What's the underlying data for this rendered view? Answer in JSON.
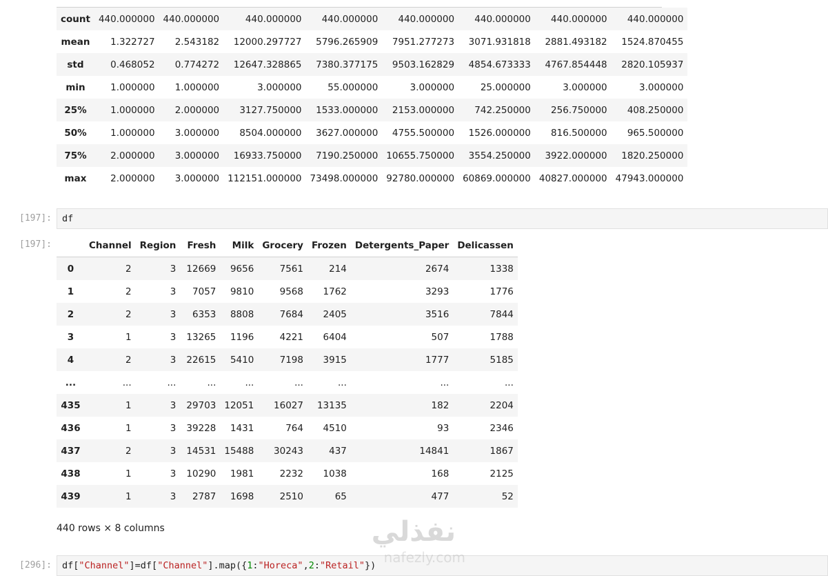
{
  "describe": {
    "rows": [
      {
        "label": "count",
        "values": [
          "440.000000",
          "440.000000",
          "440.000000",
          "440.000000",
          "440.000000",
          "440.000000",
          "440.000000",
          "440.000000"
        ]
      },
      {
        "label": "mean",
        "values": [
          "1.322727",
          "2.543182",
          "12000.297727",
          "5796.265909",
          "7951.277273",
          "3071.931818",
          "2881.493182",
          "1524.870455"
        ]
      },
      {
        "label": "std",
        "values": [
          "0.468052",
          "0.774272",
          "12647.328865",
          "7380.377175",
          "9503.162829",
          "4854.673333",
          "4767.854448",
          "2820.105937"
        ]
      },
      {
        "label": "min",
        "values": [
          "1.000000",
          "1.000000",
          "3.000000",
          "55.000000",
          "3.000000",
          "25.000000",
          "3.000000",
          "3.000000"
        ]
      },
      {
        "label": "25%",
        "values": [
          "1.000000",
          "2.000000",
          "3127.750000",
          "1533.000000",
          "2153.000000",
          "742.250000",
          "256.750000",
          "408.250000"
        ]
      },
      {
        "label": "50%",
        "values": [
          "1.000000",
          "3.000000",
          "8504.000000",
          "3627.000000",
          "4755.500000",
          "1526.000000",
          "816.500000",
          "965.500000"
        ]
      },
      {
        "label": "75%",
        "values": [
          "2.000000",
          "3.000000",
          "16933.750000",
          "7190.250000",
          "10655.750000",
          "3554.250000",
          "3922.000000",
          "1820.250000"
        ]
      },
      {
        "label": "max",
        "values": [
          "2.000000",
          "3.000000",
          "112151.000000",
          "73498.000000",
          "92780.000000",
          "60869.000000",
          "40827.000000",
          "47943.000000"
        ]
      }
    ]
  },
  "cell_197": {
    "prompt_in": "[197]:",
    "code": "df",
    "prompt_out": "[197]:"
  },
  "df": {
    "columns": [
      "Channel",
      "Region",
      "Fresh",
      "Milk",
      "Grocery",
      "Frozen",
      "Detergents_Paper",
      "Delicassen"
    ],
    "rows": [
      {
        "index": "0",
        "values": [
          "2",
          "3",
          "12669",
          "9656",
          "7561",
          "214",
          "2674",
          "1338"
        ]
      },
      {
        "index": "1",
        "values": [
          "2",
          "3",
          "7057",
          "9810",
          "9568",
          "1762",
          "3293",
          "1776"
        ]
      },
      {
        "index": "2",
        "values": [
          "2",
          "3",
          "6353",
          "8808",
          "7684",
          "2405",
          "3516",
          "7844"
        ]
      },
      {
        "index": "3",
        "values": [
          "1",
          "3",
          "13265",
          "1196",
          "4221",
          "6404",
          "507",
          "1788"
        ]
      },
      {
        "index": "4",
        "values": [
          "2",
          "3",
          "22615",
          "5410",
          "7198",
          "3915",
          "1777",
          "5185"
        ]
      },
      {
        "index": "...",
        "values": [
          "...",
          "...",
          "...",
          "...",
          "...",
          "...",
          "...",
          "..."
        ]
      },
      {
        "index": "435",
        "values": [
          "1",
          "3",
          "29703",
          "12051",
          "16027",
          "13135",
          "182",
          "2204"
        ]
      },
      {
        "index": "436",
        "values": [
          "1",
          "3",
          "39228",
          "1431",
          "764",
          "4510",
          "93",
          "2346"
        ]
      },
      {
        "index": "437",
        "values": [
          "2",
          "3",
          "14531",
          "15488",
          "30243",
          "437",
          "14841",
          "1867"
        ]
      },
      {
        "index": "438",
        "values": [
          "1",
          "3",
          "10290",
          "1981",
          "2232",
          "1038",
          "168",
          "2125"
        ]
      },
      {
        "index": "439",
        "values": [
          "1",
          "3",
          "2787",
          "1698",
          "2510",
          "65",
          "477",
          "52"
        ]
      }
    ],
    "shape_note": "440 rows × 8 columns"
  },
  "cell_296": {
    "prompt_in": "[296]:",
    "code_tokens": [
      {
        "t": "df[",
        "k": "p"
      },
      {
        "t": "\"Channel\"",
        "k": "s"
      },
      {
        "t": "]=df[",
        "k": "p"
      },
      {
        "t": "\"Channel\"",
        "k": "s"
      },
      {
        "t": "].map({",
        "k": "p"
      },
      {
        "t": "1",
        "k": "n"
      },
      {
        "t": ":",
        "k": "p"
      },
      {
        "t": "\"Horeca\"",
        "k": "s"
      },
      {
        "t": ",",
        "k": "p"
      },
      {
        "t": "2",
        "k": "n"
      },
      {
        "t": ":",
        "k": "p"
      },
      {
        "t": "\"Retail\"",
        "k": "s"
      },
      {
        "t": "})",
        "k": "p"
      }
    ]
  },
  "watermark": {
    "arabic": "نفذلي",
    "latin": "nafezly.com"
  }
}
